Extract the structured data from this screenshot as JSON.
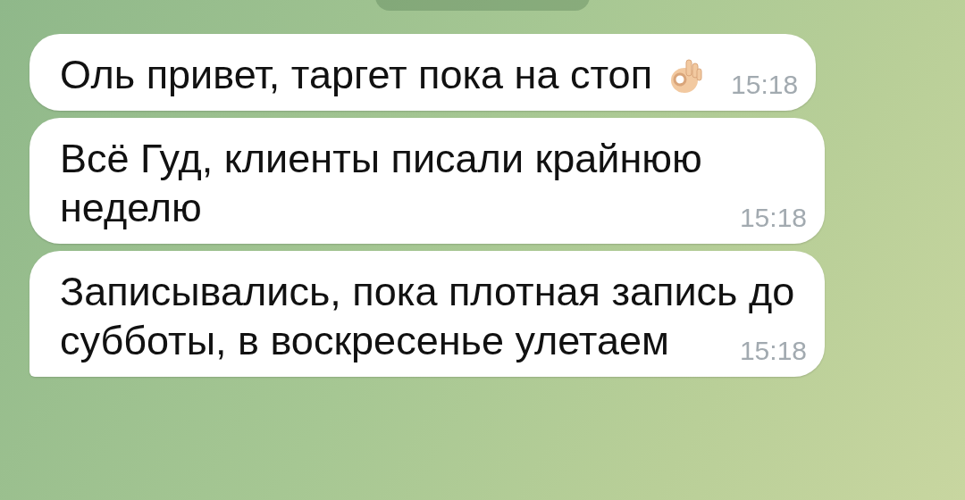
{
  "messages": [
    {
      "text": "Оль привет, таргет пока на стоп",
      "time": "15:18",
      "ok_hand": true,
      "tail": false
    },
    {
      "text": "Всё Гуд, клиенты писали крайнюю неделю",
      "time": "15:18",
      "ok_hand": false,
      "tail": false
    },
    {
      "text": "Записывались, пока плотная запись до субботы, в воскресенье улетаем",
      "time": "15:18",
      "ok_hand": false,
      "tail": true
    }
  ]
}
